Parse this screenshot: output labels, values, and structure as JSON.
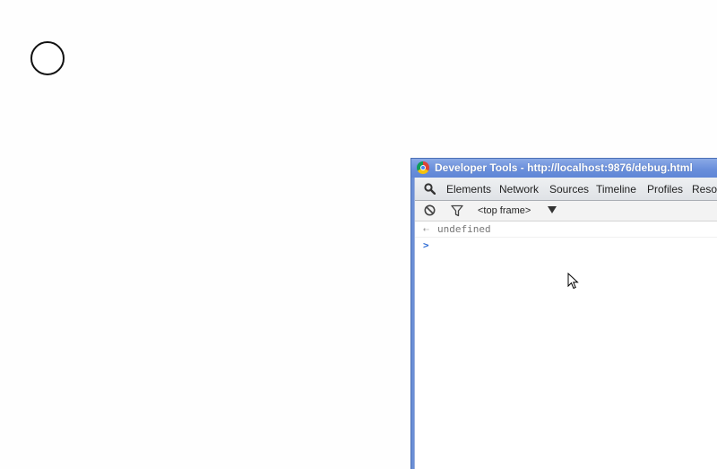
{
  "devtools": {
    "title": "Developer Tools - http://localhost:9876/debug.html",
    "tabs": [
      {
        "label": "Elements"
      },
      {
        "label": "Network"
      },
      {
        "label": "Sources"
      },
      {
        "label": "Timeline"
      },
      {
        "label": "Profiles"
      },
      {
        "label": "Resou"
      }
    ],
    "console": {
      "frame_selector": "<top frame>",
      "entries": [
        {
          "marker": "⇠",
          "value": "undefined"
        }
      ],
      "prompt": ">"
    }
  },
  "colors": {
    "titlebar": "#6a8fdb",
    "prompt": "#2d6bd4",
    "result_text": "#777777"
  }
}
